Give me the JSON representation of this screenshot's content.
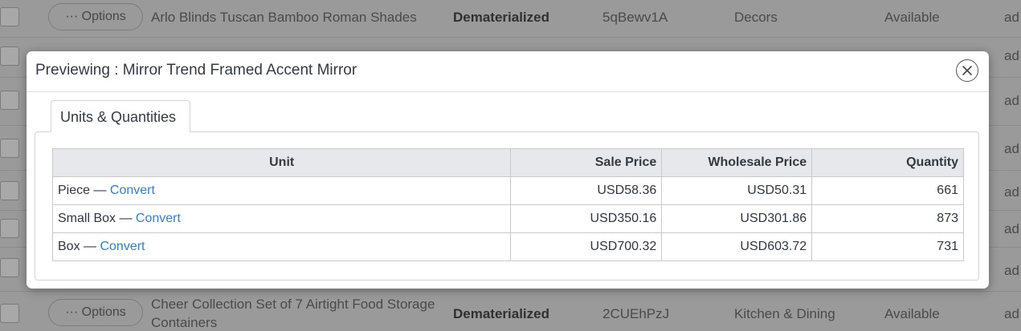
{
  "background_rows": [
    {
      "options_label": "··· Options",
      "name": "Arlo Blinds Tuscan Bamboo Roman Shades",
      "status": "Dematerialized",
      "code": "5qBewv1A",
      "category": "Decors",
      "availability": "Available",
      "extra": "ad"
    },
    {
      "options_label": "··· Options",
      "name": "Cheer Collection Set of 7 Airtight Food Storage",
      "name2": "Containers",
      "status": "Dematerialized",
      "code": "2CUEhPzJ",
      "category": "Kitchen & Dining",
      "availability": "Available",
      "extra": "ad"
    }
  ],
  "right_edge_fragments": [
    "ad",
    "ad",
    "ad",
    "ad",
    "ad",
    "ad"
  ],
  "modal": {
    "title": "Previewing : Mirror Trend Framed Accent Mirror",
    "tab_label": "Units & Quantities",
    "table": {
      "headers": {
        "unit": "Unit",
        "sale_price": "Sale Price",
        "wholesale_price": "Wholesale Price",
        "quantity": "Quantity"
      },
      "rows": [
        {
          "unit": "Piece",
          "separator": " — ",
          "link": "Convert",
          "sale_price": "USD58.36",
          "wholesale_price": "USD50.31",
          "quantity": "661"
        },
        {
          "unit": "Small Box",
          "separator": " — ",
          "link": "Convert",
          "sale_price": "USD350.16",
          "wholesale_price": "USD301.86",
          "quantity": "873"
        },
        {
          "unit": "Box",
          "separator": " — ",
          "link": "Convert",
          "sale_price": "USD700.32",
          "wholesale_price": "USD603.72",
          "quantity": "731"
        }
      ]
    }
  },
  "colors": {
    "link": "#2f7fd1",
    "overlay": "#9a9a9a",
    "header_bg": "#e6e8eb"
  }
}
